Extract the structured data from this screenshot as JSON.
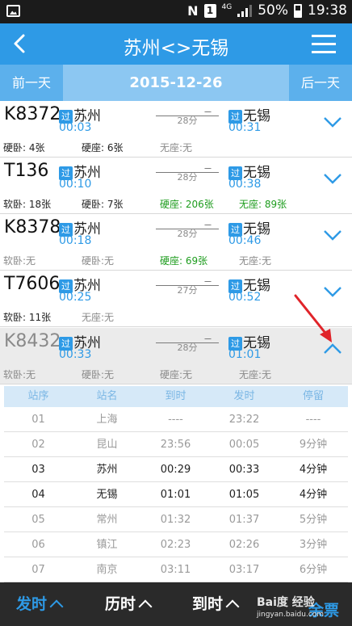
{
  "status_bar": {
    "battery": "50%",
    "time": "19:38",
    "network": "4G",
    "sim": "1",
    "nfc": "N"
  },
  "nav": {
    "title": "苏州<>无锡"
  },
  "date_bar": {
    "prev": "前一天",
    "date": "2015-12-26",
    "next": "后一天"
  },
  "trains": [
    {
      "code": "K8372",
      "badge": "过",
      "from": "苏州",
      "dep": "00:03",
      "duration": "28分",
      "to": "无锡",
      "arr": "00:31",
      "seats": [
        "硬卧: 4张",
        "硬座: 6张",
        "无座:无"
      ]
    },
    {
      "code": "T136",
      "badge": "过",
      "from": "苏州",
      "dep": "00:10",
      "duration": "28分",
      "to": "无锡",
      "arr": "00:38",
      "seats": [
        "软卧: 18张",
        "硬卧: 7张",
        "硬座: 206张",
        "无座: 89张"
      ]
    },
    {
      "code": "K8378",
      "badge": "过",
      "from": "苏州",
      "dep": "00:18",
      "duration": "28分",
      "to": "无锡",
      "arr": "00:46",
      "seats": [
        "软卧:无",
        "硬卧:无",
        "硬座: 69张",
        "无座:无"
      ]
    },
    {
      "code": "T7606",
      "badge": "过",
      "from": "苏州",
      "dep": "00:25",
      "duration": "27分",
      "to": "无锡",
      "arr": "00:52",
      "seats": [
        "软卧: 11张",
        "无座:无"
      ]
    },
    {
      "code": "K8432",
      "badge": "过",
      "from": "苏州",
      "dep": "00:33",
      "duration": "28分",
      "to": "无锡",
      "arr": "01:01",
      "seats": [
        "软卧:无",
        "硬卧:无",
        "硬座:无",
        "无座:无"
      ]
    }
  ],
  "stops": {
    "headers": [
      "站序",
      "站名",
      "到时",
      "发时",
      "停留"
    ],
    "rows": [
      [
        "01",
        "上海",
        "----",
        "23:22",
        "----"
      ],
      [
        "02",
        "昆山",
        "23:56",
        "00:05",
        "9分钟"
      ],
      [
        "03",
        "苏州",
        "00:29",
        "00:33",
        "4分钟"
      ],
      [
        "04",
        "无锡",
        "01:01",
        "01:05",
        "4分钟"
      ],
      [
        "05",
        "常州",
        "01:32",
        "01:37",
        "5分钟"
      ],
      [
        "06",
        "镇江",
        "02:23",
        "02:26",
        "3分钟"
      ],
      [
        "07",
        "南京",
        "03:11",
        "03:17",
        "6分钟"
      ]
    ]
  },
  "tabs": {
    "departure": "发时",
    "duration": "历时",
    "arrival": "到时",
    "ticket": "余票"
  },
  "watermark": {
    "title": "Bai度 经验",
    "url": "jingyan.baidu.com"
  },
  "colors": {
    "primary": "#2e9ae6",
    "available": "#1d9c1d",
    "bottom_bar": "#2a2a2a"
  }
}
